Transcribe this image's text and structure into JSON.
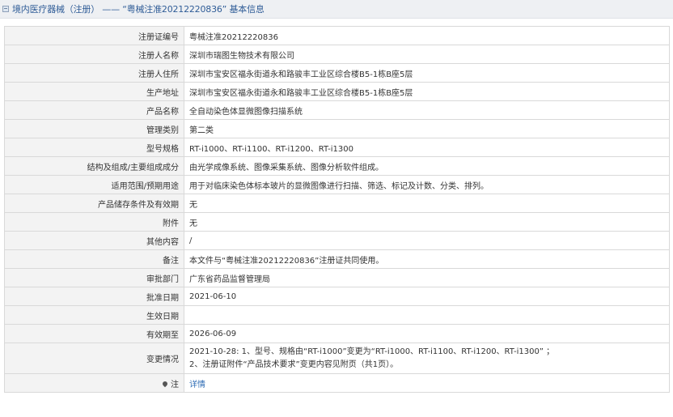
{
  "header": {
    "title": "境内医疗器械（注册） —— “粤械注准20212220836” 基本信息"
  },
  "rows": [
    {
      "label": "注册证编号",
      "value": "粤械注准20212220836"
    },
    {
      "label": "注册人名称",
      "value": "深圳市瑞图生物技术有限公司"
    },
    {
      "label": "注册人住所",
      "value": "深圳市宝安区福永街道永和路骏丰工业区综合楼B5-1栋B座5层"
    },
    {
      "label": "生产地址",
      "value": "深圳市宝安区福永街道永和路骏丰工业区综合楼B5-1栋B座5层"
    },
    {
      "label": "产品名称",
      "value": "全自动染色体显微图像扫描系统"
    },
    {
      "label": "管理类别",
      "value": "第二类"
    },
    {
      "label": "型号规格",
      "value": "RT-i1000、RT-i1100、RT-i1200、RT-i1300"
    },
    {
      "label": "结构及组成/主要组成成分",
      "value": "由光学成像系统、图像采集系统、图像分析软件组成。"
    },
    {
      "label": "适用范围/预期用途",
      "value": "用于对临床染色体标本玻片的显微图像进行扫描、筛选、标记及计数、分类、排列。"
    },
    {
      "label": "产品储存条件及有效期",
      "value": "无"
    },
    {
      "label": "附件",
      "value": "无"
    },
    {
      "label": "其他内容",
      "value": "/"
    },
    {
      "label": "备注",
      "value": "本文件与“粤械注准20212220836”注册证共同使用。"
    },
    {
      "label": "审批部门",
      "value": "广东省药品监督管理局"
    },
    {
      "label": "批准日期",
      "value": "2021-06-10"
    },
    {
      "label": "生效日期",
      "value": ""
    },
    {
      "label": "有效期至",
      "value": "2026-06-09"
    }
  ],
  "change": {
    "label": "变更情况",
    "line1": "2021-10-28: 1、型号、规格由“RT-i1000”变更为“RT-i1000、RT-i1100、RT-i1200、RT-i1300” ；",
    "line2": "2、注册证附件“产品技术要求”变更内容见附页（共1页）。"
  },
  "note": {
    "icon": "pin-icon",
    "label": "注",
    "link_text": "详情"
  }
}
